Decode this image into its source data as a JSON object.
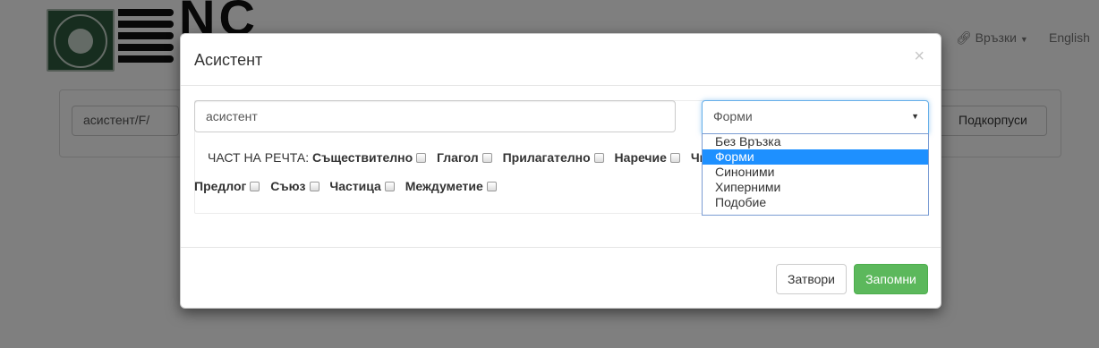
{
  "background": {
    "nav_links_label": "Връзки",
    "nav_english_label": "English",
    "search_value": "асистент/F/",
    "subcorpora_button_label": "Подкорпуси"
  },
  "modal": {
    "title": "Асистент",
    "close_glyph": "×",
    "search_value": "асистент",
    "part_of_speech_label": "ЧАСТ НА РЕЧТА:",
    "parts_of_speech": [
      "Съществително",
      "Глагол",
      "Прилагателно",
      "Наречие",
      "Чи",
      "Предлог",
      "Съюз",
      "Частица",
      "Междуметие"
    ],
    "relation_select": {
      "selected": "Форми",
      "options": [
        "Без Връзка",
        "Форми",
        "Синоними",
        "Хиперними",
        "Подобие"
      ],
      "highlighted_option": "Форми"
    },
    "close_button_label": "Затвори",
    "save_button_label": "Запомни"
  },
  "colors": {
    "primary_green": "#5cb85c",
    "select_highlight": "#1e90ff",
    "focus_border": "#66afe9"
  },
  "icons": {
    "links": "link-icon",
    "select_arrow": "triangle-down-icon",
    "close": "close-icon"
  }
}
